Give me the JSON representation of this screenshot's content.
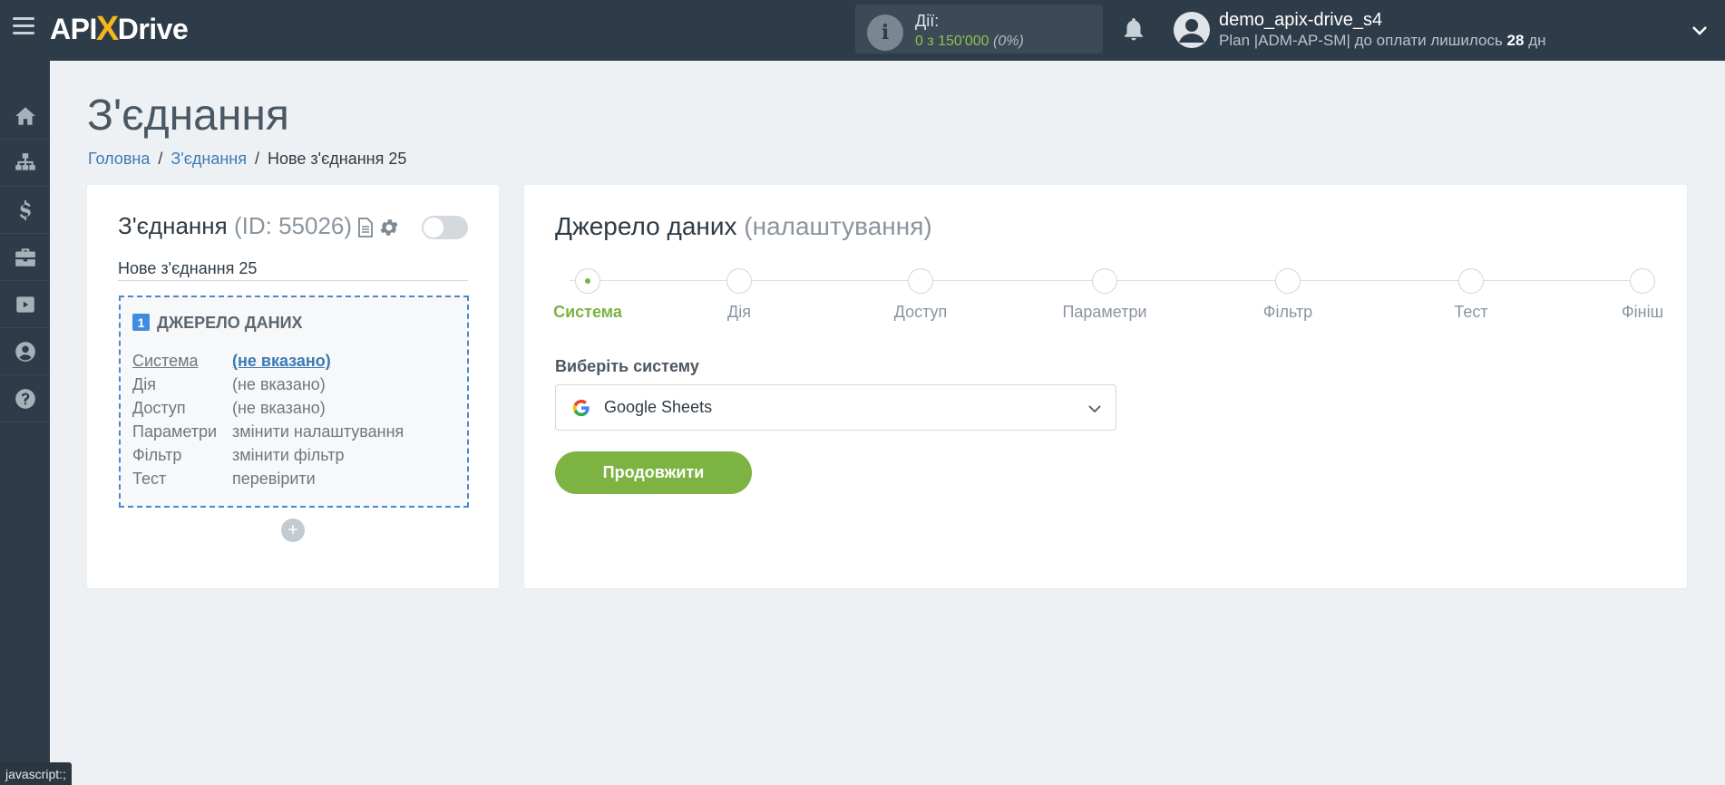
{
  "header": {
    "logo": {
      "a": "API",
      "x": "X",
      "drive": "Drive"
    },
    "actions": {
      "label": "Дії:",
      "value": "0 з 150'000",
      "percent": "(0%)"
    },
    "user": {
      "name": "demo_apix-drive_s4",
      "plan_prefix": "Plan |ADM-AP-SM| до оплати лишилось ",
      "days": "28",
      "days_suffix": " дн"
    }
  },
  "sidebar": {
    "items": [
      {
        "icon": "home-icon"
      },
      {
        "icon": "sitemap-icon"
      },
      {
        "icon": "dollar-icon"
      },
      {
        "icon": "briefcase-icon"
      },
      {
        "icon": "youtube-icon"
      },
      {
        "icon": "user-icon"
      },
      {
        "icon": "help-icon"
      }
    ]
  },
  "page": {
    "title": "З'єднання",
    "breadcrumb": [
      "Головна",
      "З'єднання",
      "Нове з'єднання 25"
    ]
  },
  "connection": {
    "title": "З'єднання",
    "id_text": "(ID: 55026)",
    "name": "Нове з'єднання 25",
    "source": {
      "number": "1",
      "header": "ДЖЕРЕЛО ДАНИХ",
      "rows": [
        {
          "key": "Система",
          "value": "(не вказано)"
        },
        {
          "key": "Дія",
          "value": "(не вказано)"
        },
        {
          "key": "Доступ",
          "value": "(не вказано)"
        },
        {
          "key": "Параметри",
          "value": "змінити налаштування"
        },
        {
          "key": "Фільтр",
          "value": "змінити фільтр"
        },
        {
          "key": "Тест",
          "value": "перевірити"
        }
      ]
    },
    "add_label": "+"
  },
  "source_panel": {
    "title": "Джерело даних",
    "subtitle": "(налаштування)",
    "steps": [
      "Система",
      "Дія",
      "Доступ",
      "Параметри",
      "Фільтр",
      "Тест",
      "Фініш"
    ],
    "active_step": 0,
    "select_label": "Виберіть систему",
    "selected_system": "Google Sheets",
    "continue_label": "Продовжити"
  },
  "status_bar": "javascript:;",
  "colors": {
    "topbar": "#2e3c49",
    "accent_green": "#7cb342",
    "link_blue": "#3c7ab5",
    "logo_yellow": "#f4b61a"
  }
}
